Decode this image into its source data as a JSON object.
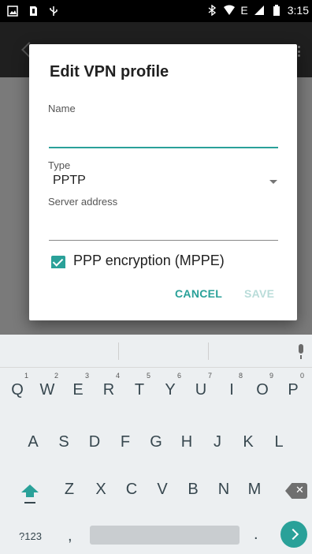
{
  "status_bar": {
    "time": "3:15",
    "network_label": "E",
    "colors": {
      "icons": "#ffffff",
      "background": "#000000"
    }
  },
  "dialog": {
    "title": "Edit VPN profile",
    "name_label": "Name",
    "name_value": "",
    "type_label": "Type",
    "type_value": "PPTP",
    "server_label": "Server address",
    "server_value": "",
    "encryption_label": "PPP encryption (MPPE)",
    "encryption_checked": true,
    "cancel_label": "CANCEL",
    "save_label": "SAVE",
    "accent_color": "#2aa199"
  },
  "keyboard": {
    "row1": [
      {
        "key": "Q",
        "hint": "1"
      },
      {
        "key": "W",
        "hint": "2"
      },
      {
        "key": "E",
        "hint": "3"
      },
      {
        "key": "R",
        "hint": "4"
      },
      {
        "key": "T",
        "hint": "5"
      },
      {
        "key": "Y",
        "hint": "6"
      },
      {
        "key": "U",
        "hint": "7"
      },
      {
        "key": "I",
        "hint": "8"
      },
      {
        "key": "O",
        "hint": "9"
      },
      {
        "key": "P",
        "hint": "0"
      }
    ],
    "row2": [
      "A",
      "S",
      "D",
      "F",
      "G",
      "H",
      "J",
      "K",
      "L"
    ],
    "row3": [
      "Z",
      "X",
      "C",
      "V",
      "B",
      "N",
      "M"
    ],
    "symbols_label": "?123",
    "comma_label": ",",
    "period_label": "."
  }
}
